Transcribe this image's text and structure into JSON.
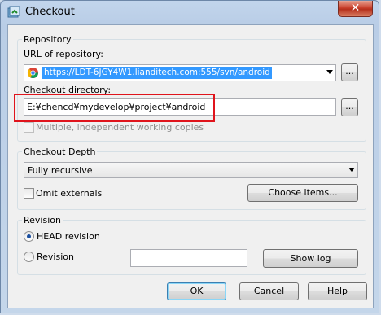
{
  "window": {
    "title": "Checkout",
    "close_glyph": "✕"
  },
  "repository": {
    "group_title": "Repository",
    "url_label": "URL of repository:",
    "url_value": "https://LDT-6JGY4W1.lianditech.com:555/svn/android",
    "browse_label": "...",
    "checkout_dir_label": "Checkout directory:",
    "checkout_dir_value": "E:¥chencd¥mydevelop¥project¥android",
    "multiple_copies_label": "Multiple, independent working copies"
  },
  "depth": {
    "group_title": "Checkout Depth",
    "selected": "Fully recursive",
    "omit_externals_label": "Omit externals",
    "choose_items_label": "Choose items..."
  },
  "revision": {
    "group_title": "Revision",
    "head_label": "HEAD revision",
    "revision_label": "Revision",
    "revision_value": "",
    "show_log_label": "Show log",
    "selected": "HEAD revision"
  },
  "footer": {
    "ok_label": "OK",
    "cancel_label": "Cancel",
    "help_label": "Help"
  },
  "icons": {
    "app": "tortoisesvn-checkout-icon",
    "url_favicon": "chrome-icon"
  },
  "colors": {
    "highlight_border": "#e0141c",
    "selection": "#3399ff"
  }
}
